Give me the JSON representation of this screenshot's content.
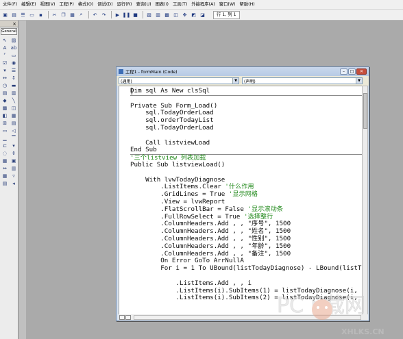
{
  "menubar": {
    "items": [
      "文件(F)",
      "编辑(E)",
      "视图(V)",
      "工程(P)",
      "格式(O)",
      "调试(D)",
      "运行(R)",
      "查询(U)",
      "图表(I)",
      "工具(T)",
      "外接程序(A)",
      "窗口(W)",
      "帮助(H)"
    ]
  },
  "toolbar": {
    "position": "行 1, 列 1"
  },
  "toolbox": {
    "tab": "General",
    "close": "×",
    "tools": [
      "pointer-icon",
      "picturebox-icon",
      "label-icon",
      "textbox-icon",
      "frame-icon",
      "commandbutton-icon",
      "checkbox-icon",
      "optionbutton-icon",
      "combobox-icon",
      "listbox-icon",
      "hscrollbar-icon",
      "vscrollbar-icon",
      "timer-icon",
      "drivelistbox-icon",
      "dirlistbox-icon",
      "filelistbox-icon",
      "shape-icon",
      "line-icon",
      "image-icon",
      "data-icon",
      "ole-icon",
      "imagelist-icon",
      "treeview-icon",
      "listview-icon",
      "progressbar-icon",
      "slider-icon",
      "statusbar-icon",
      "toolbar-icon",
      "tabstrip-icon",
      "imagecombo-icon",
      "animation-icon",
      "updown-icon",
      "monthview-icon",
      "dtpicker-icon",
      "flatscrollbar-icon",
      "coolbar-icon",
      "datagrid-icon",
      "datacombo-icon",
      "datalist-icon",
      "adodc-icon"
    ]
  },
  "code_window": {
    "title": "工程1 - formMain (Code)",
    "object_combo": "(通用)",
    "proc_combo": "(声明)",
    "lines": [
      {
        "code": "Dim sql As New clsSql",
        "comment": ""
      },
      {
        "code": "",
        "comment": ""
      },
      {
        "code": "Private Sub Form_Load()",
        "comment": ""
      },
      {
        "code": "    sql.TodayOrderLoad",
        "comment": ""
      },
      {
        "code": "    sql.orderTodayList",
        "comment": ""
      },
      {
        "code": "    sql.TodayOrderLoad",
        "comment": ""
      },
      {
        "code": "",
        "comment": ""
      },
      {
        "code": "    Call listviewLoad",
        "comment": ""
      },
      {
        "code": "End Sub",
        "comment": ""
      },
      {
        "code": "",
        "comment": "'三个listview 列表加载"
      },
      {
        "code": "Public Sub listviewLoad()",
        "comment": ""
      },
      {
        "code": "",
        "comment": ""
      },
      {
        "code": "    With lvwTodayDiagnose",
        "comment": ""
      },
      {
        "code": "        .ListItems.Clear ",
        "comment": "'什么作用"
      },
      {
        "code": "        .GridLines = True ",
        "comment": "'显示网格"
      },
      {
        "code": "        .View = lvwReport",
        "comment": ""
      },
      {
        "code": "        .FlatScrollBar = False ",
        "comment": "'显示滚动条"
      },
      {
        "code": "        .FullRowSelect = True ",
        "comment": "'选择整行"
      },
      {
        "code": "        .ColumnHeaders.Add , , \"序号\", 1500",
        "comment": ""
      },
      {
        "code": "        .ColumnHeaders.Add , , \"姓名\", 1500",
        "comment": ""
      },
      {
        "code": "        .ColumnHeaders.Add , , \"性别\", 1500",
        "comment": ""
      },
      {
        "code": "        .ColumnHeaders.Add , , \"年龄\", 1500",
        "comment": ""
      },
      {
        "code": "        .ColumnHeaders.Add , , \"备注\", 1500",
        "comment": ""
      },
      {
        "code": "        On Error GoTo ArrNullA",
        "comment": ""
      },
      {
        "code": "        For i = 1 To UBound(listTodayDiagnose) - LBound(listTodayDiagnose)",
        "comment": ""
      },
      {
        "code": "",
        "comment": ""
      },
      {
        "code": "            .ListItems.Add , , i",
        "comment": ""
      },
      {
        "code": "            .ListItems(i).SubItems(1) = listTodayDiagnose(i, 1)",
        "comment": ""
      },
      {
        "code": "            .ListItems(i).SubItems(2) = listTodayDiagnose(i, 2)",
        "comment": ""
      }
    ]
  },
  "watermark": {
    "line1": "PC下载网",
    "line2": "XHLKS.CN"
  }
}
